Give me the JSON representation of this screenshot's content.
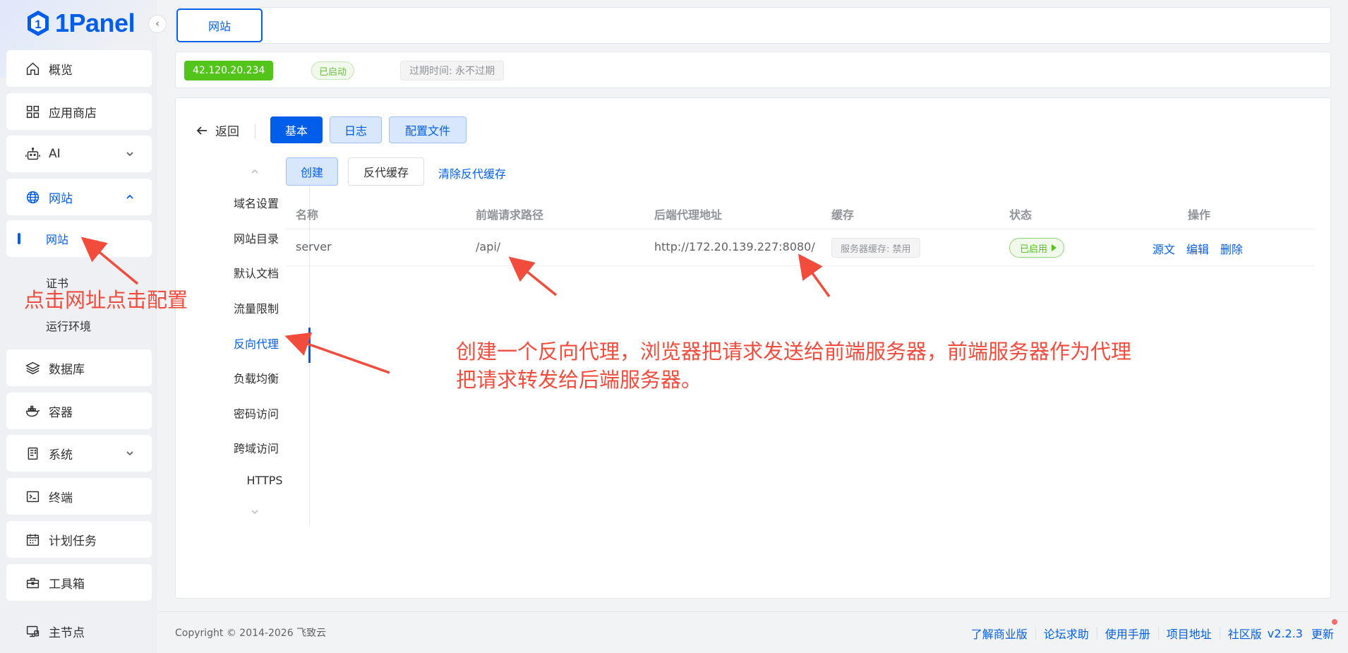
{
  "app": {
    "brand": "1Panel"
  },
  "sidebar": {
    "items": [
      {
        "label": "概览",
        "icon": "home-icon"
      },
      {
        "label": "应用商店",
        "icon": "grid-icon"
      },
      {
        "label": "AI",
        "icon": "robot-icon"
      },
      {
        "label": "网站",
        "icon": "globe-icon"
      },
      {
        "label": "数据库",
        "icon": "layers-icon"
      },
      {
        "label": "容器",
        "icon": "docker-icon"
      },
      {
        "label": "系统",
        "icon": "server-icon"
      },
      {
        "label": "终端",
        "icon": "terminal-icon"
      },
      {
        "label": "计划任务",
        "icon": "calendar-icon"
      },
      {
        "label": "工具箱",
        "icon": "toolbox-icon"
      },
      {
        "label": "主节点",
        "icon": "node-icon"
      }
    ],
    "website_sub": [
      {
        "label": "网站"
      },
      {
        "label": "证书"
      },
      {
        "label": "运行环境"
      }
    ]
  },
  "tabbar": {
    "site_tab": "网站"
  },
  "info": {
    "ip": "42.120.20.234",
    "status": "已启动",
    "expire": "过期时间: 永不过期"
  },
  "toolbar": {
    "back": "返回",
    "tabs": [
      "基本",
      "日志",
      "配置文件"
    ]
  },
  "inner_menu": {
    "items": [
      "域名设置",
      "网站目录",
      "默认文档",
      "流量限制",
      "反向代理",
      "负载均衡",
      "密码访问",
      "跨域访问",
      "HTTPS"
    ],
    "active": "反向代理"
  },
  "proxy": {
    "create": "创建",
    "cache": "反代缓存",
    "clear_cache": "清除反代缓存"
  },
  "table": {
    "headers": [
      "名称",
      "前端请求路径",
      "后端代理地址",
      "缓存",
      "状态",
      "操作"
    ],
    "rows": [
      {
        "name": "server",
        "path": "/api/",
        "backend": "http://172.20.139.227:8080/",
        "cache": "服务器缓存: 禁用",
        "status": "已启用",
        "ops": [
          "源文",
          "编辑",
          "删除"
        ]
      }
    ]
  },
  "footer": {
    "copyright": "Copyright © 2014-2026 飞致云",
    "links": [
      "了解商业版",
      "论坛求助",
      "使用手册",
      "项目地址",
      "社区版"
    ],
    "version": "v2.2.3",
    "update": "更新"
  },
  "annotations": {
    "left": "点击网址点击配置",
    "right_line1": "创建一个反向代理，浏览器把请求发送给前端服务器，前端服务器作为代理",
    "right_line2": "把请求转发给后端服务器。"
  },
  "colors": {
    "primary": "#005eeb",
    "success": "#52c41a",
    "annotation": "#f24c3d"
  }
}
